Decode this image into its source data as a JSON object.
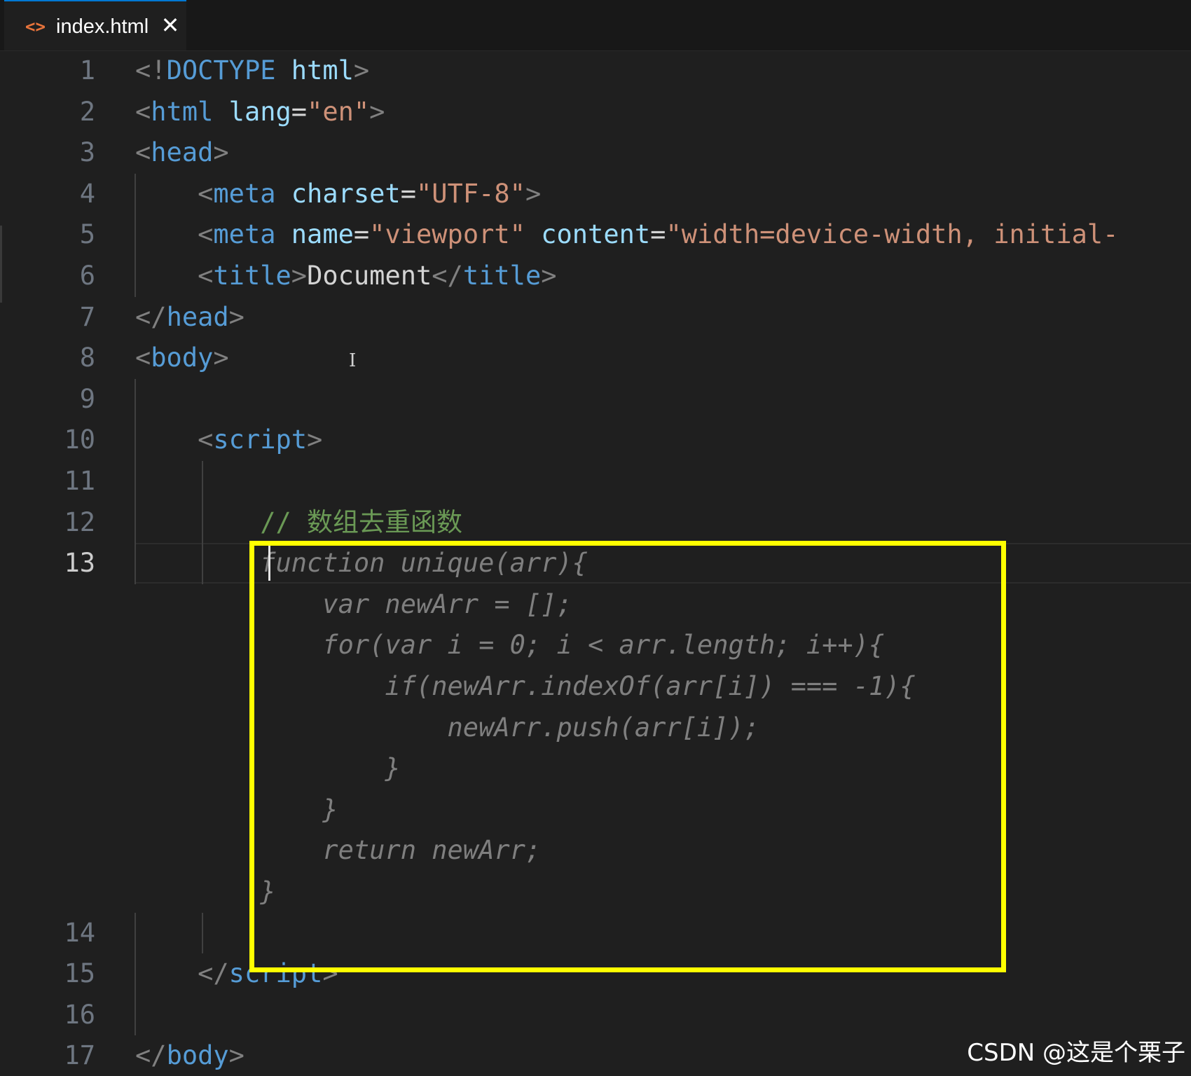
{
  "tab": {
    "icon": "<>",
    "label": "index.html",
    "close": "✕"
  },
  "lines": [
    {
      "n": "1",
      "t": [
        [
          "tk-punct",
          "<!"
        ],
        [
          "tk-tag",
          "DOCTYPE"
        ],
        [
          "tk-text",
          " "
        ],
        [
          "tk-attr",
          "html"
        ],
        [
          "tk-punct",
          ">"
        ]
      ]
    },
    {
      "n": "2",
      "t": [
        [
          "tk-punct",
          "<"
        ],
        [
          "tk-tag",
          "html"
        ],
        [
          "tk-text",
          " "
        ],
        [
          "tk-attr",
          "lang"
        ],
        [
          "tk-text",
          "="
        ],
        [
          "tk-str",
          "\"en\""
        ],
        [
          "tk-punct",
          ">"
        ]
      ]
    },
    {
      "n": "3",
      "t": [
        [
          "tk-punct",
          "<"
        ],
        [
          "tk-tag",
          "head"
        ],
        [
          "tk-punct",
          ">"
        ]
      ]
    },
    {
      "n": "4",
      "t": [
        [
          "tk-text",
          "    "
        ],
        [
          "tk-punct",
          "<"
        ],
        [
          "tk-tag",
          "meta"
        ],
        [
          "tk-text",
          " "
        ],
        [
          "tk-attr",
          "charset"
        ],
        [
          "tk-text",
          "="
        ],
        [
          "tk-str",
          "\"UTF-8\""
        ],
        [
          "tk-punct",
          ">"
        ]
      ]
    },
    {
      "n": "5",
      "t": [
        [
          "tk-text",
          "    "
        ],
        [
          "tk-punct",
          "<"
        ],
        [
          "tk-tag",
          "meta"
        ],
        [
          "tk-text",
          " "
        ],
        [
          "tk-attr",
          "name"
        ],
        [
          "tk-text",
          "="
        ],
        [
          "tk-str",
          "\"viewport\""
        ],
        [
          "tk-text",
          " "
        ],
        [
          "tk-attr",
          "content"
        ],
        [
          "tk-text",
          "="
        ],
        [
          "tk-str",
          "\"width=device-width, initial-"
        ]
      ]
    },
    {
      "n": "6",
      "t": [
        [
          "tk-text",
          "    "
        ],
        [
          "tk-punct",
          "<"
        ],
        [
          "tk-tag",
          "title"
        ],
        [
          "tk-punct",
          ">"
        ],
        [
          "tk-text",
          "Document"
        ],
        [
          "tk-punct",
          "</"
        ],
        [
          "tk-tag",
          "title"
        ],
        [
          "tk-punct",
          ">"
        ]
      ]
    },
    {
      "n": "7",
      "t": [
        [
          "tk-punct",
          "</"
        ],
        [
          "tk-tag",
          "head"
        ],
        [
          "tk-punct",
          ">"
        ]
      ]
    },
    {
      "n": "8",
      "t": [
        [
          "tk-punct",
          "<"
        ],
        [
          "tk-tag",
          "body"
        ],
        [
          "tk-punct",
          ">"
        ]
      ]
    },
    {
      "n": "9",
      "t": []
    },
    {
      "n": "10",
      "t": [
        [
          "tk-text",
          "    "
        ],
        [
          "tk-punct",
          "<"
        ],
        [
          "tk-tag",
          "script"
        ],
        [
          "tk-punct",
          ">"
        ]
      ]
    },
    {
      "n": "11",
      "t": []
    },
    {
      "n": "12",
      "t": [
        [
          "tk-text",
          "        "
        ],
        [
          "tk-comment",
          "// 数组去重函数"
        ]
      ]
    },
    {
      "n": "13",
      "t": [],
      "active": true
    },
    {
      "n": "14",
      "t": []
    },
    {
      "n": "15",
      "t": [
        [
          "tk-text",
          "    "
        ],
        [
          "tk-punct",
          "</"
        ],
        [
          "tk-tag",
          "script"
        ],
        [
          "tk-punct",
          ">"
        ]
      ]
    },
    {
      "n": "16",
      "t": []
    },
    {
      "n": "17",
      "t": [
        [
          "tk-punct",
          "</"
        ],
        [
          "tk-tag",
          "body"
        ],
        [
          "tk-punct",
          ">"
        ]
      ]
    }
  ],
  "suggestion": [
    "        function unique(arr){",
    "            var newArr = [];",
    "            for(var i = 0; i < arr.length; i++){",
    "                if(newArr.indexOf(arr[i]) === -1){",
    "                    newArr.push(arr[i]);",
    "                }",
    "            }",
    "            return newArr;",
    "        }"
  ],
  "watermark": "CSDN @这是个栗子"
}
